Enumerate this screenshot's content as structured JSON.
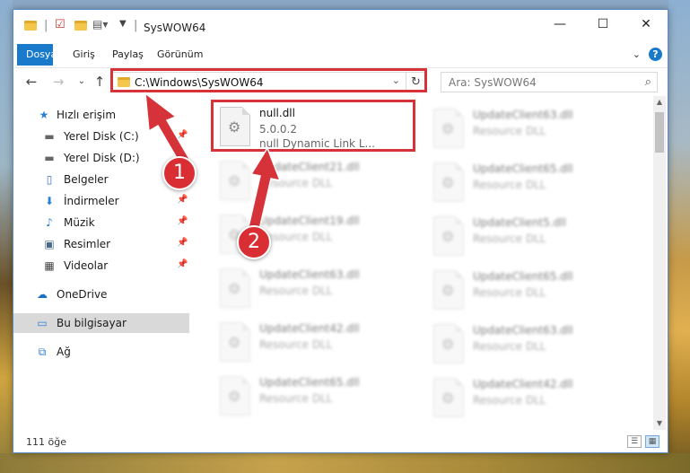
{
  "window": {
    "title": "SysWOW64",
    "controls": {
      "minimize": "—",
      "maximize": "☐",
      "close": "✕"
    }
  },
  "ribbon": {
    "tabs": [
      "Dosya",
      "Giriş",
      "Paylaş",
      "Görünüm"
    ],
    "active_tab": "Dosya",
    "help_icon": "?"
  },
  "address": {
    "path": "C:\\Windows\\SysWOW64",
    "search_placeholder": "Ara: SysWOW64"
  },
  "sidebar": {
    "items": [
      {
        "label": "Hızlı erişim",
        "icon": "star-icon",
        "pinned": false
      },
      {
        "label": "Yerel Disk (C:)",
        "icon": "drive-icon",
        "pinned": true
      },
      {
        "label": "Yerel Disk (D:)",
        "icon": "drive-icon",
        "pinned": true
      },
      {
        "label": "Belgeler",
        "icon": "documents-icon",
        "pinned": true
      },
      {
        "label": "İndirmeler",
        "icon": "download-icon",
        "pinned": true
      },
      {
        "label": "Müzik",
        "icon": "music-icon",
        "pinned": true
      },
      {
        "label": "Resimler",
        "icon": "pictures-icon",
        "pinned": true
      },
      {
        "label": "Videolar",
        "icon": "video-icon",
        "pinned": true
      },
      {
        "label": "OneDrive",
        "icon": "cloud-icon",
        "pinned": false
      },
      {
        "label": "Bu bilgisayar",
        "icon": "computer-icon",
        "pinned": false,
        "selected": true
      },
      {
        "label": "Ağ",
        "icon": "network-icon",
        "pinned": false
      }
    ]
  },
  "files": {
    "highlighted": {
      "name": "null.dll",
      "version": "5.0.0.2",
      "description": "null Dynamic Link L..."
    },
    "left_column": [
      {
        "name": "UpdateClient21.dll",
        "type": "Resource DLL"
      },
      {
        "name": "UpdateClient19.dll",
        "type": "Resource DLL"
      },
      {
        "name": "UpdateClient63.dll",
        "type": "Resource DLL"
      },
      {
        "name": "UpdateClient42.dll",
        "type": "Resource DLL"
      },
      {
        "name": "UpdateClient65.dll",
        "type": "Resource DLL"
      }
    ],
    "right_column": [
      {
        "name": "UpdateClient63.dll",
        "type": "Resource DLL"
      },
      {
        "name": "UpdateClient65.dll",
        "type": "Resource DLL"
      },
      {
        "name": "UpdateClient5.dll",
        "type": "Resource DLL"
      },
      {
        "name": "UpdateClient65.dll",
        "type": "Resource DLL"
      },
      {
        "name": "UpdateClient63.dll",
        "type": "Resource DLL"
      },
      {
        "name": "UpdateClient42.dll",
        "type": "Resource DLL"
      }
    ]
  },
  "status": {
    "item_count": "111 öğe"
  },
  "annotations": {
    "step1": "1",
    "step2": "2",
    "color": "#d6323a"
  }
}
